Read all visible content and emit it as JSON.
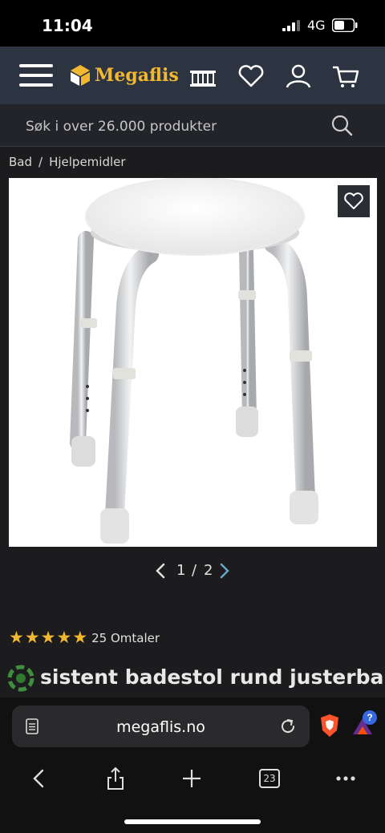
{
  "status_bar": {
    "time": "11:04",
    "network": "4G"
  },
  "header": {
    "brand": "Megaflis",
    "icons": [
      "menu-icon",
      "store-icon",
      "heart-icon",
      "user-icon",
      "cart-icon"
    ]
  },
  "search": {
    "placeholder": "Søk i over 26.000 produkter"
  },
  "breadcrumb": {
    "items": [
      "Bad",
      "Hjelpemidler"
    ],
    "separator": "/"
  },
  "gallery": {
    "current": "1",
    "separator": "/",
    "total": "2"
  },
  "rating": {
    "stars": 5,
    "reviews_label": "25 Omtaler"
  },
  "product": {
    "title_visible": "sistent badestol rund justerbar"
  },
  "browser": {
    "url": "megaflis.no",
    "tabs_count": "23",
    "extension_badge": "?"
  },
  "colors": {
    "accent": "#f1b731",
    "header_bg": "#2d3441",
    "page_bg": "#1c1c1e"
  }
}
